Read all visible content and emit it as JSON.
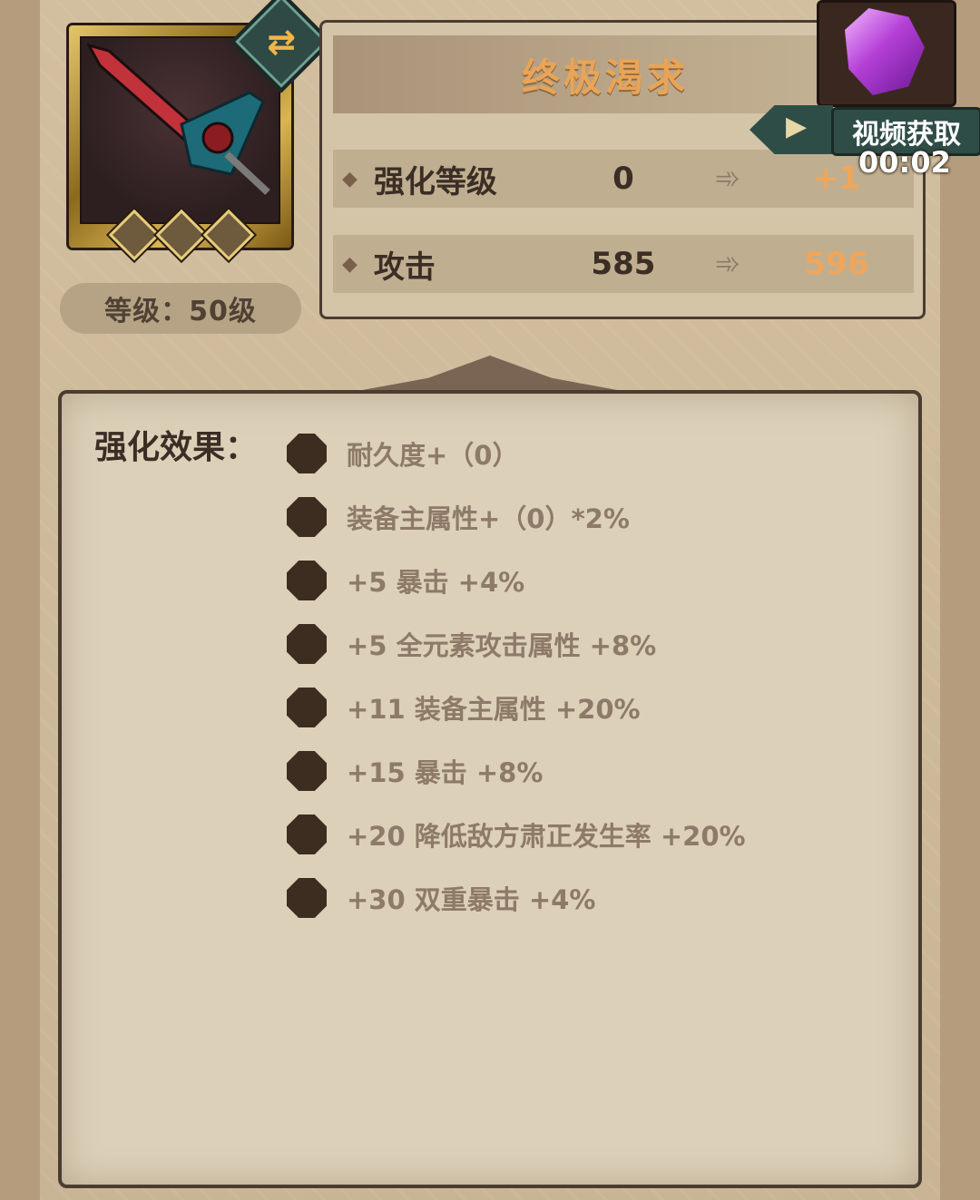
{
  "item": {
    "name": "终极渴求",
    "level": "等级：50级",
    "icon": "sword-icon",
    "swap_icon": "swap-icon"
  },
  "stats": [
    {
      "label": "强化等级",
      "current": "0",
      "next": "+1"
    },
    {
      "label": "攻击",
      "current": "585",
      "next": "596"
    }
  ],
  "video_reward": {
    "label": "视频获取",
    "timer": "00:02",
    "icon": "play-video-icon",
    "reward_icon": "purple-crystal-icon"
  },
  "effects": {
    "title": "强化效果：",
    "items": [
      "耐久度+（0）",
      "装备主属性+（0）*2%",
      "+5  暴击 +4%",
      "+5  全元素攻击属性 +8%",
      "+11  装备主属性 +20%",
      "+15  暴击 +8%",
      "+20  降低敌方肃正发生率 +20%",
      "+30  双重暴击 +4%"
    ]
  },
  "colors": {
    "title_orange": "#e9a456",
    "next_value_orange": "#f0a65a",
    "effect_text": "#8d7a68",
    "dark_text": "#3a2e25"
  }
}
